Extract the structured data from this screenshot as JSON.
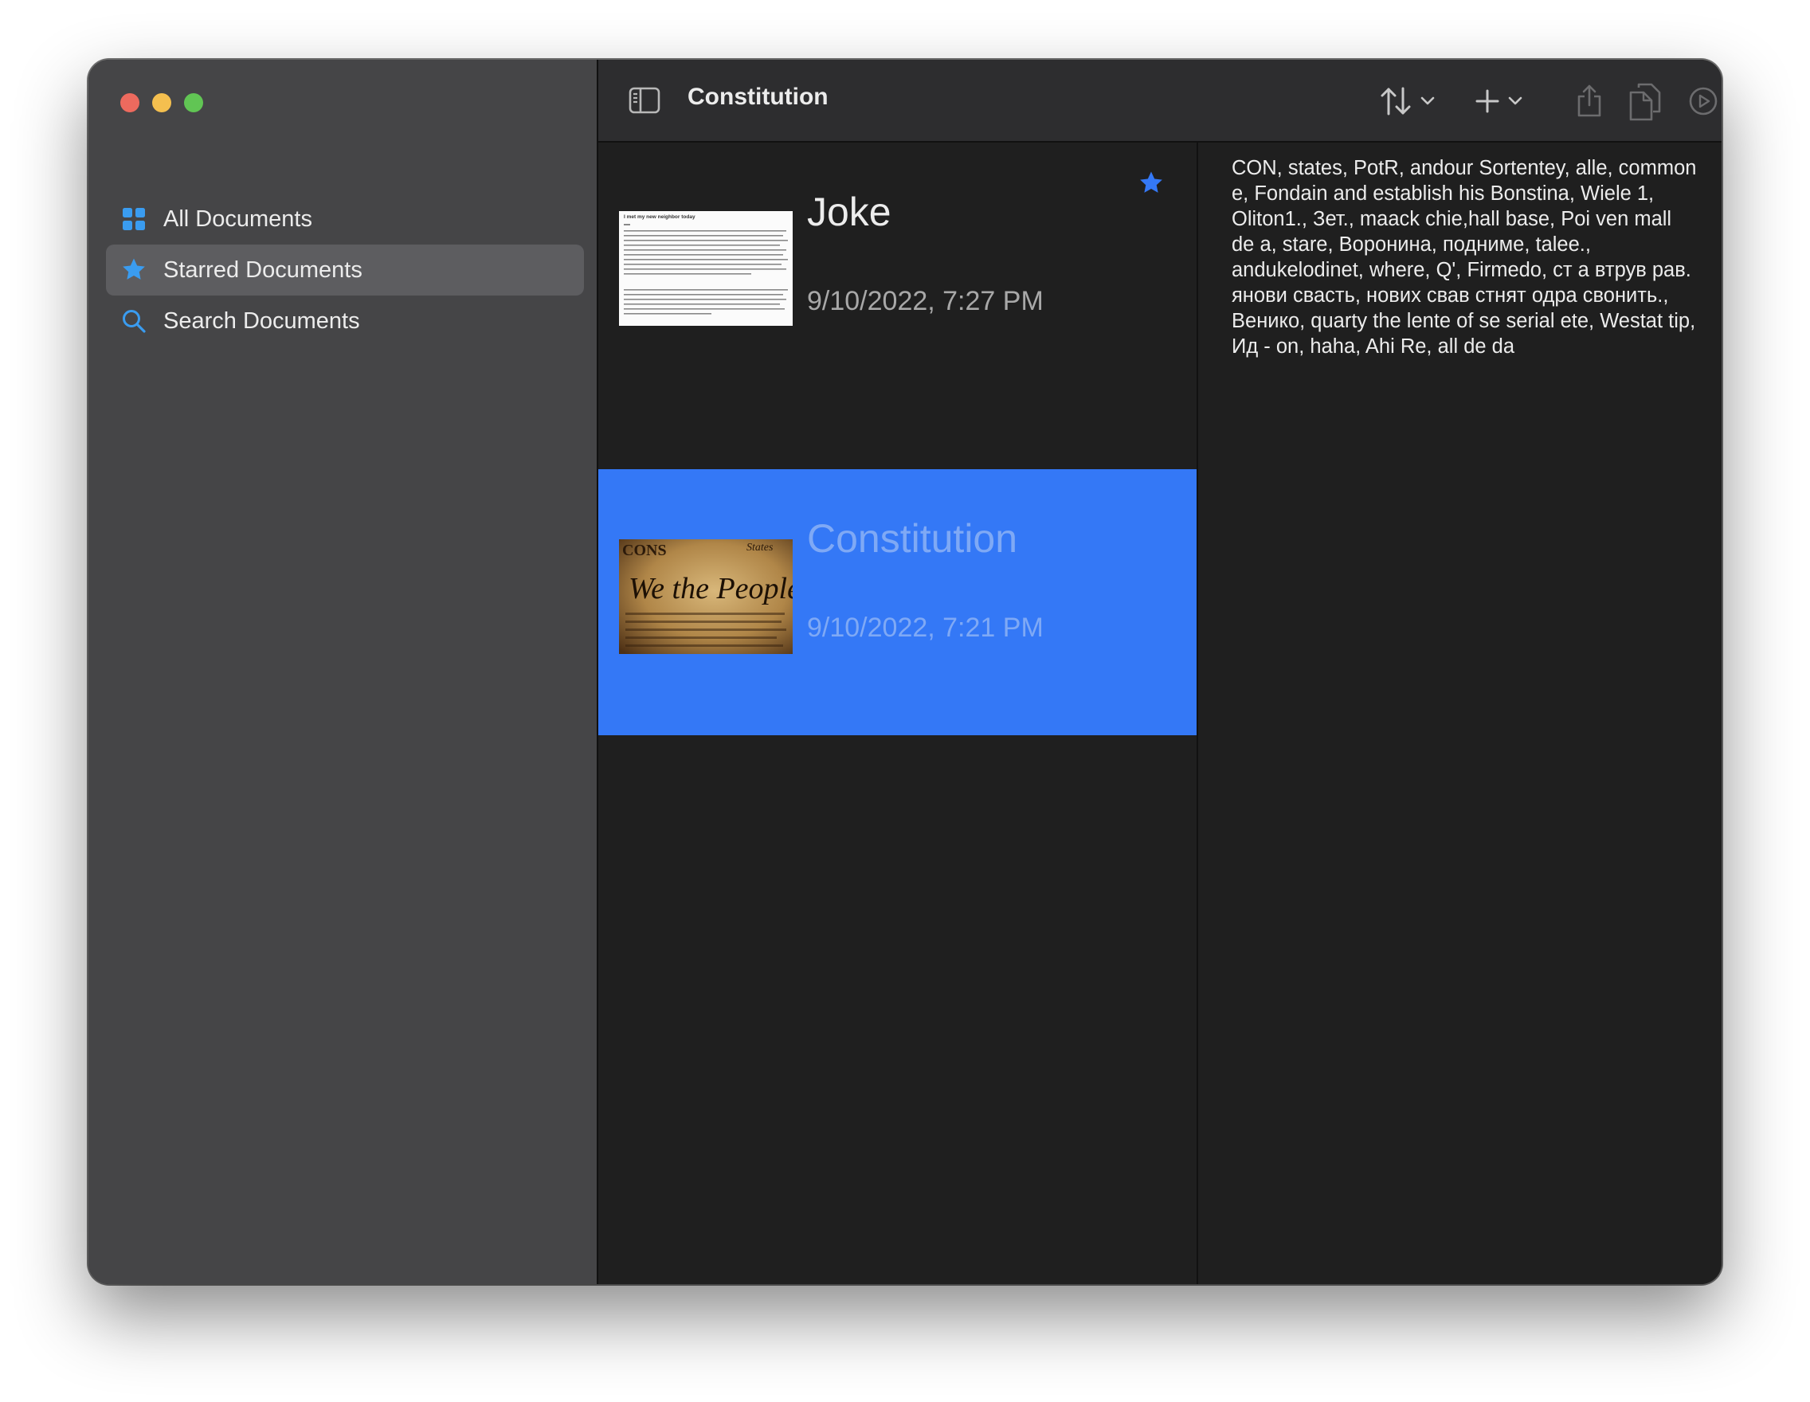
{
  "window": {
    "title": "Constitution"
  },
  "sidebar": {
    "items": [
      {
        "label": "All Documents",
        "icon": "grid-icon",
        "selected": false
      },
      {
        "label": "Starred Documents",
        "icon": "star-icon",
        "selected": true
      },
      {
        "label": "Search Documents",
        "icon": "search-icon",
        "selected": false
      }
    ]
  },
  "toolbar": {
    "sort_icon": "sort-arrows-icon",
    "add_icon": "plus-icon",
    "share_icon": "share-icon",
    "copy_icon": "copy-icon",
    "play_icon": "play-icon",
    "settings_icon": "gear-icon"
  },
  "documents": [
    {
      "title": "Joke",
      "date": "9/10/2022, 7:27 PM",
      "starred": true,
      "selected": false,
      "thumbnail_heading": "I met my new neighbor today"
    },
    {
      "title": "Constitution",
      "date": "9/10/2022, 7:21 PM",
      "starred": false,
      "selected": true,
      "thumbnail_text": "We the People"
    }
  ],
  "preview": {
    "text": "CON, states, PotR, andour Sortentey, alle, common e, Fondain and establish his Bonstina, Wiele 1, Oliton1., Зет., maack chie,hall base, Poi ven mall de a, stare, Воронина, подниме, talee., andukelodinet, where, Q', Firmedo, ст а втрув рав. янови свасть, нових свав стнят одра свонить., Венико, quarty the lente of se serial ete, Westat tip, Ид - on, haha, Ahi Re, all de da"
  },
  "colors": {
    "accent": "#3478f6",
    "sidebar_bg": "#454547",
    "list_bg": "#1f1f1f",
    "icon_blue": "#3a9cf0"
  }
}
